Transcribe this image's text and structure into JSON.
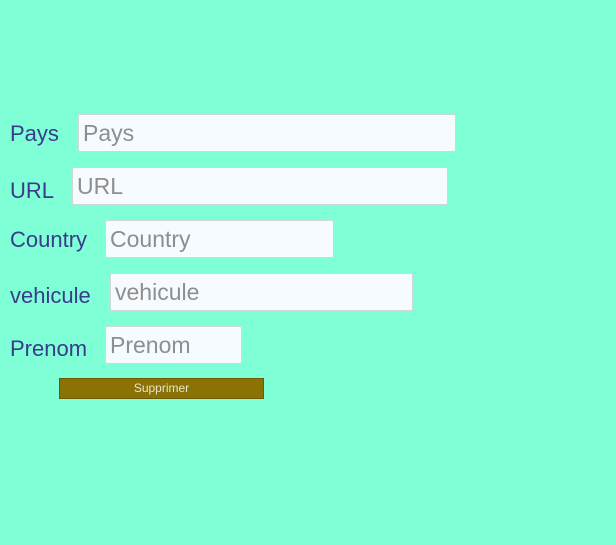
{
  "form": {
    "fields": [
      {
        "label": "Pays",
        "placeholder": "Pays",
        "value": ""
      },
      {
        "label": "URL",
        "placeholder": "URL",
        "value": ""
      },
      {
        "label": "Country",
        "placeholder": "Country",
        "value": ""
      },
      {
        "label": "vehicule",
        "placeholder": "vehicule",
        "value": ""
      },
      {
        "label": "Prenom",
        "placeholder": "Prenom",
        "value": ""
      }
    ],
    "submit_label": "Supprimer"
  },
  "colors": {
    "background": "#7effd6",
    "label_text": "#3b3b8c",
    "input_background": "#f5fbff",
    "button_background": "#8a7205",
    "button_text": "#e9e4cf"
  }
}
